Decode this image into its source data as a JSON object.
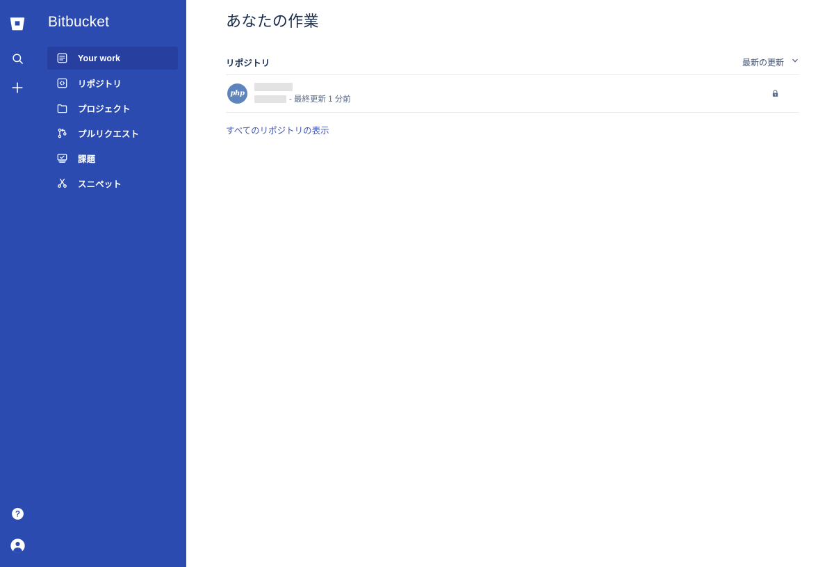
{
  "app": {
    "brand": "Bitbucket",
    "logo_icon": "bitbucket-logo-icon"
  },
  "rail": {
    "search_icon": "search-icon",
    "create_icon": "plus-icon",
    "help_icon": "help-circle-icon",
    "profile_icon": "user-avatar-icon"
  },
  "sidebar": {
    "items": [
      {
        "label": "Your work",
        "icon": "your-work-icon",
        "active": true
      },
      {
        "label": "リポジトリ",
        "icon": "repository-icon",
        "active": false
      },
      {
        "label": "プロジェクト",
        "icon": "folder-icon",
        "active": false
      },
      {
        "label": "プルリクエスト",
        "icon": "pull-request-icon",
        "active": false
      },
      {
        "label": "課題",
        "icon": "issues-icon",
        "active": false
      },
      {
        "label": "スニペット",
        "icon": "snippets-icon",
        "active": false
      }
    ]
  },
  "main": {
    "page_title": "あなたの作業",
    "section": {
      "title": "リポジトリ",
      "sort": {
        "label": "最新の更新",
        "chevron_icon": "chevron-down-icon"
      }
    },
    "repositories": [
      {
        "avatar_text": "php",
        "name_redacted": true,
        "owner_redacted": true,
        "updated_text": "- 最終更新 1 分前",
        "visibility_icon": "lock-icon",
        "private": true
      }
    ],
    "view_all_label": "すべてのリポジトリの表示"
  },
  "colors": {
    "sidebar_bg": "#2b4bb0",
    "sidebar_active": "#2740a0",
    "text_primary": "#172b4d",
    "text_subtle": "#5e6c84",
    "link": "#4056b3",
    "divider": "#e8eaee",
    "avatar_bg": "#5d84bd",
    "redaction": "#e3e3e3"
  }
}
